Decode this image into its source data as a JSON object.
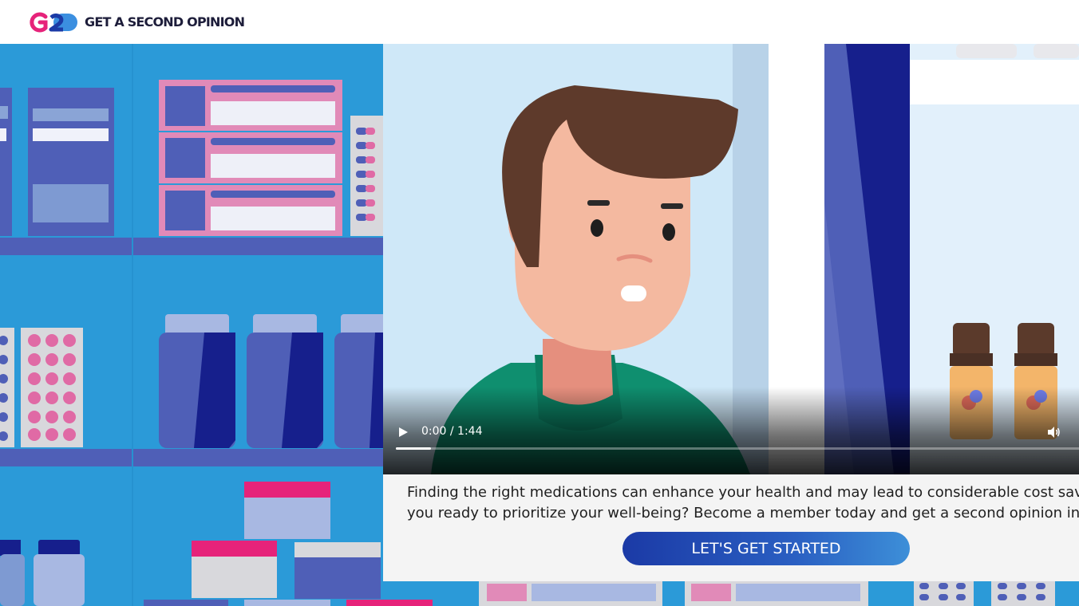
{
  "brand": {
    "logo_mark": "G2",
    "name": "GET A SECOND OPINION",
    "colors": {
      "pink": "#e6237a",
      "blue": "#2c6fd0"
    }
  },
  "video": {
    "play_icon": "play-icon",
    "time_display": "0:00 / 1:44",
    "volume_icon": "volume-icon",
    "progress": 0.05
  },
  "promo": {
    "line1": "Finding the right medications can enhance your health and may lead to considerable cost savings",
    "line2": "you ready to prioritize your well-being? Become a member today and get a second opinion in mi",
    "cta_label": "LET'S GET STARTED"
  },
  "colors": {
    "background": "#2b9ad8",
    "cta_start": "#1b3aa6",
    "cta_end": "#3d8fd8",
    "panel": "#f4f4f4"
  }
}
